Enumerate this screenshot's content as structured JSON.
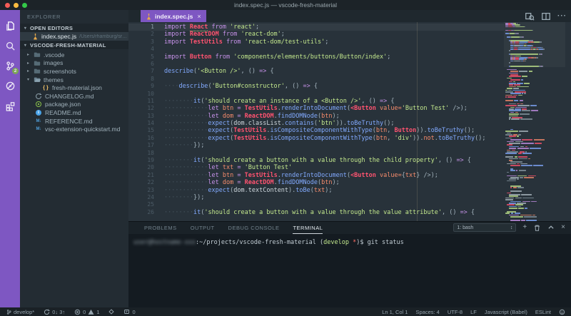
{
  "window": {
    "title": "index.spec.js — vscode-fresh-material",
    "traffic_lights": [
      "#f45c57",
      "#fdbc40",
      "#33c748"
    ]
  },
  "colors": {
    "accent": "#7e57c2",
    "badge_green": "#7cb342",
    "editor_bg": "#28323a",
    "sidebar_bg": "#232c33",
    "panel_bg": "#141b21",
    "keyword": "#c792ea",
    "entity_red": "#ff5370",
    "string_green": "#c3e88d",
    "function_blue": "#82aaff",
    "variable_orange": "#f78c6c"
  },
  "activity_bar": {
    "items": [
      {
        "name": "explorer",
        "icon": "files-icon",
        "active": true
      },
      {
        "name": "search",
        "icon": "search-icon"
      },
      {
        "name": "source-control",
        "icon": "git-branch-icon",
        "badge": "2"
      },
      {
        "name": "debug",
        "icon": "debug-icon"
      },
      {
        "name": "extensions",
        "icon": "extensions-icon"
      }
    ]
  },
  "sidebar": {
    "title": "EXPLORER",
    "open_editors_label": "OPEN EDITORS",
    "folder_label": "VSCODE-FRESH-MATERIAL",
    "open_editors": [
      {
        "file": "index.spec.js",
        "path": "/Users/rhamburg/src/gpe-ser…",
        "icon": "flask-icon",
        "selected": true
      }
    ],
    "tree": [
      {
        "label": ".vscode",
        "type": "folder",
        "expanded": false,
        "indent": 0
      },
      {
        "label": "images",
        "type": "folder",
        "expanded": false,
        "indent": 0
      },
      {
        "label": "screenshots",
        "type": "folder",
        "expanded": false,
        "indent": 0
      },
      {
        "label": "themes",
        "type": "folder",
        "expanded": true,
        "indent": 0
      },
      {
        "label": "fresh-material.json",
        "type": "json",
        "indent": 1
      },
      {
        "label": "CHANGELOG.md",
        "type": "changelog",
        "indent": 0
      },
      {
        "label": "package.json",
        "type": "npm",
        "indent": 0
      },
      {
        "label": "README.md",
        "type": "readme",
        "indent": 0
      },
      {
        "label": "REFERENCE.md",
        "type": "markdown",
        "indent": 0
      },
      {
        "label": "vsc-extension-quickstart.md",
        "type": "markdown",
        "indent": 0
      }
    ]
  },
  "editor": {
    "tabs": [
      {
        "label": "index.spec.js",
        "icon": "flask-icon",
        "active": true,
        "close": "×"
      }
    ],
    "actions": [
      {
        "name": "open-preview",
        "icon": "preview-icon"
      },
      {
        "name": "split-editor",
        "icon": "split-editor-icon"
      },
      {
        "name": "more-actions",
        "icon": "ellipsis-icon",
        "glyph": "···"
      }
    ],
    "code_lines": [
      {
        "indent": 0,
        "current": true,
        "tokens": [
          [
            "k",
            "import "
          ],
          [
            "ru",
            "React"
          ],
          [
            "k",
            " from "
          ],
          [
            "s",
            "'react'"
          ],
          [
            "p",
            ";"
          ]
        ]
      },
      {
        "indent": 0,
        "tokens": [
          [
            "k",
            "import "
          ],
          [
            "r",
            "ReactDOM"
          ],
          [
            "k",
            " from "
          ],
          [
            "s",
            "'react-dom'"
          ],
          [
            "p",
            ";"
          ]
        ]
      },
      {
        "indent": 0,
        "tokens": [
          [
            "k",
            "import "
          ],
          [
            "r",
            "TestUtils"
          ],
          [
            "k",
            " from "
          ],
          [
            "s",
            "'react-dom/test-utils'"
          ],
          [
            "p",
            ";"
          ]
        ]
      },
      {
        "indent": 0,
        "tokens": []
      },
      {
        "indent": 0,
        "tokens": [
          [
            "k",
            "import "
          ],
          [
            "r",
            "Button"
          ],
          [
            "k",
            " from "
          ],
          [
            "s",
            "'components/elements/buttons/Button/index'"
          ],
          [
            "p",
            ";"
          ]
        ]
      },
      {
        "indent": 0,
        "tokens": []
      },
      {
        "indent": 0,
        "tokens": [
          [
            "f",
            "describe"
          ],
          [
            "p",
            "("
          ],
          [
            "s",
            "'<Button />'"
          ],
          [
            "p",
            ", () "
          ],
          [
            "k",
            "=>"
          ],
          [
            "p",
            " {"
          ]
        ]
      },
      {
        "indent": 0,
        "tokens": []
      },
      {
        "indent": 4,
        "tokens": [
          [
            "f",
            "describe"
          ],
          [
            "p",
            "("
          ],
          [
            "s",
            "'Button#constructor'"
          ],
          [
            "p",
            ", () "
          ],
          [
            "k",
            "=>"
          ],
          [
            "p",
            " {"
          ]
        ]
      },
      {
        "indent": 0,
        "tokens": []
      },
      {
        "indent": 8,
        "tokens": [
          [
            "f",
            "it"
          ],
          [
            "p",
            "("
          ],
          [
            "s",
            "'should create an instance of a <Button />'"
          ],
          [
            "p",
            ", () "
          ],
          [
            "k",
            "=>"
          ],
          [
            "p",
            " {"
          ]
        ]
      },
      {
        "indent": 12,
        "tokens": [
          [
            "k",
            "let "
          ],
          [
            "o",
            "btn"
          ],
          [
            "k",
            " = "
          ],
          [
            "r",
            "TestUtils"
          ],
          [
            "p",
            "."
          ],
          [
            "f",
            "renderIntoDocument"
          ],
          [
            "p",
            "("
          ],
          [
            "r",
            "<Button"
          ],
          [
            "o",
            " value="
          ],
          [
            "s",
            "'Button Test'"
          ],
          [
            "p",
            " />);"
          ]
        ]
      },
      {
        "indent": 12,
        "tokens": [
          [
            "k",
            "let "
          ],
          [
            "o",
            "dom"
          ],
          [
            "k",
            " = "
          ],
          [
            "r",
            "ReactDOM"
          ],
          [
            "p",
            "."
          ],
          [
            "f",
            "findDOMNode"
          ],
          [
            "p",
            "("
          ],
          [
            "o",
            "btn"
          ],
          [
            "p",
            ");"
          ]
        ]
      },
      {
        "indent": 12,
        "tokens": [
          [
            "f",
            "expect"
          ],
          [
            "p",
            "("
          ],
          [
            "w",
            "dom"
          ],
          [
            "p",
            "."
          ],
          [
            "w",
            "classList"
          ],
          [
            "p",
            "."
          ],
          [
            "f",
            "contains"
          ],
          [
            "p",
            "("
          ],
          [
            "s",
            "'btn'"
          ],
          [
            "p",
            "))."
          ],
          [
            "f",
            "toBeTruthy"
          ],
          [
            "p",
            "();"
          ]
        ]
      },
      {
        "indent": 12,
        "tokens": [
          [
            "f",
            "expect"
          ],
          [
            "p",
            "("
          ],
          [
            "r",
            "TestUtils"
          ],
          [
            "p",
            "."
          ],
          [
            "f",
            "isCompositeComponentWithType"
          ],
          [
            "p",
            "("
          ],
          [
            "o",
            "btn"
          ],
          [
            "p",
            ", "
          ],
          [
            "r",
            "Button"
          ],
          [
            "p",
            "))."
          ],
          [
            "f",
            "toBeTruthy"
          ],
          [
            "p",
            "();"
          ]
        ]
      },
      {
        "indent": 12,
        "tokens": [
          [
            "f",
            "expect"
          ],
          [
            "p",
            "("
          ],
          [
            "r",
            "TestUtils"
          ],
          [
            "p",
            "."
          ],
          [
            "f",
            "isCompositeComponentWithType"
          ],
          [
            "p",
            "("
          ],
          [
            "o",
            "btn"
          ],
          [
            "p",
            ", "
          ],
          [
            "s",
            "'div'"
          ],
          [
            "p",
            "))."
          ],
          [
            "o",
            "not"
          ],
          [
            "p",
            "."
          ],
          [
            "f",
            "toBeTruthy"
          ],
          [
            "p",
            "();"
          ]
        ]
      },
      {
        "indent": 8,
        "tokens": [
          [
            "p",
            "});"
          ]
        ]
      },
      {
        "indent": 0,
        "tokens": []
      },
      {
        "indent": 8,
        "tokens": [
          [
            "f",
            "it"
          ],
          [
            "p",
            "("
          ],
          [
            "s",
            "'should create a button with a value through the child property'"
          ],
          [
            "p",
            ", () "
          ],
          [
            "k",
            "=>"
          ],
          [
            "p",
            " {"
          ]
        ]
      },
      {
        "indent": 12,
        "tokens": [
          [
            "k",
            "let "
          ],
          [
            "o",
            "txt"
          ],
          [
            "k",
            " = "
          ],
          [
            "s",
            "'Button Test'"
          ]
        ]
      },
      {
        "indent": 12,
        "tokens": [
          [
            "k",
            "let "
          ],
          [
            "o",
            "btn"
          ],
          [
            "k",
            " = "
          ],
          [
            "r",
            "TestUtils"
          ],
          [
            "p",
            "."
          ],
          [
            "f",
            "renderIntoDocument"
          ],
          [
            "p",
            "("
          ],
          [
            "r",
            "<Button"
          ],
          [
            "o",
            " value="
          ],
          [
            "p",
            "{"
          ],
          [
            "o",
            "txt"
          ],
          [
            "p",
            "} />);"
          ]
        ]
      },
      {
        "indent": 12,
        "tokens": [
          [
            "k",
            "let "
          ],
          [
            "o",
            "dom"
          ],
          [
            "k",
            " = "
          ],
          [
            "r",
            "ReactDOM"
          ],
          [
            "p",
            "."
          ],
          [
            "f",
            "findDOMNode"
          ],
          [
            "p",
            "("
          ],
          [
            "o",
            "btn"
          ],
          [
            "p",
            ");"
          ]
        ]
      },
      {
        "indent": 12,
        "tokens": [
          [
            "f",
            "expect"
          ],
          [
            "p",
            "("
          ],
          [
            "w",
            "dom"
          ],
          [
            "p",
            "."
          ],
          [
            "w",
            "textContent"
          ],
          [
            "p",
            ")."
          ],
          [
            "f",
            "toBe"
          ],
          [
            "p",
            "("
          ],
          [
            "o",
            "txt"
          ],
          [
            "p",
            ");"
          ]
        ]
      },
      {
        "indent": 8,
        "tokens": [
          [
            "p",
            "});"
          ]
        ]
      },
      {
        "indent": 0,
        "tokens": []
      },
      {
        "indent": 8,
        "tokens": [
          [
            "f",
            "it"
          ],
          [
            "p",
            "("
          ],
          [
            "s",
            "'should create a button with a value through the value attribute'"
          ],
          [
            "p",
            ", () "
          ],
          [
            "k",
            "=>"
          ],
          [
            "p",
            " {"
          ]
        ]
      }
    ]
  },
  "panel": {
    "tabs": [
      {
        "label": "PROBLEMS"
      },
      {
        "label": "OUTPUT"
      },
      {
        "label": "DEBUG CONSOLE"
      },
      {
        "label": "TERMINAL",
        "active": true
      }
    ],
    "terminal_select": "1: bash",
    "actions": [
      {
        "name": "new-terminal",
        "icon": "plus-icon",
        "glyph": "+"
      },
      {
        "name": "kill-terminal",
        "icon": "trash-icon"
      },
      {
        "name": "maximize-panel",
        "icon": "chevron-up-icon"
      },
      {
        "name": "close-panel",
        "icon": "close-icon",
        "glyph": "×"
      }
    ],
    "prompt": {
      "redacted_user": "user@hostname-xxx",
      "path_prefix": ":~/projects/vscode-fresh-material (",
      "branch": "develop",
      "dirty_marker": " *",
      "path_suffix": ")$ ",
      "command": "git status"
    }
  },
  "status_bar": {
    "left": [
      {
        "name": "git-branch-status",
        "icon": "branch-icon",
        "label": "develop*"
      },
      {
        "name": "sync-status",
        "icon": "sync-icon",
        "label": "0↓ 3↑"
      },
      {
        "name": "problems-status",
        "icon": "error-icon",
        "label": "0",
        "icon2": "warning-icon",
        "label2": "1"
      },
      {
        "name": "misc-status-1",
        "icon": "diamond-icon",
        "label": ""
      },
      {
        "name": "misc-status-2",
        "icon": "box-icon",
        "label": "0"
      }
    ],
    "right": [
      {
        "name": "cursor-position",
        "label": "Ln 1, Col 1"
      },
      {
        "name": "indentation",
        "label": "Spaces: 4"
      },
      {
        "name": "encoding",
        "label": "UTF-8"
      },
      {
        "name": "eol",
        "label": "LF"
      },
      {
        "name": "language-mode",
        "label": "Javascript (Babel)"
      },
      {
        "name": "eslint-status",
        "label": "ESLint"
      },
      {
        "name": "feedback",
        "icon": "smiley-icon",
        "label": ""
      }
    ]
  }
}
